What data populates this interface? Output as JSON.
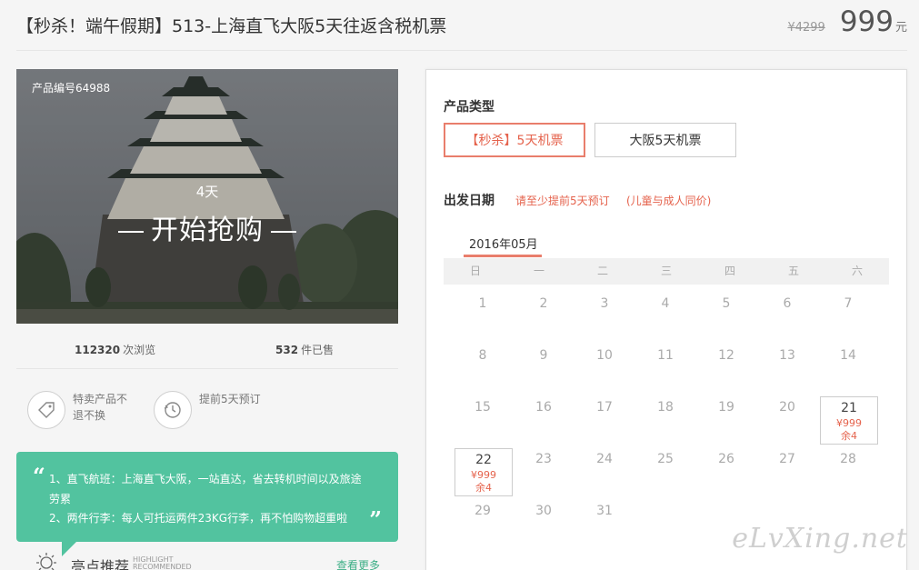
{
  "header": {
    "title": "【秒杀！端午假期】513-上海直飞大阪5天往返含税机票",
    "price_old": "¥4299",
    "price_new": "999",
    "price_unit": "元"
  },
  "hero": {
    "product_code": "产品编号64988",
    "days": "4天",
    "start_text": "开始抢购"
  },
  "stats": {
    "views_count": "112320",
    "views_label": "次浏览",
    "sold_count": "532",
    "sold_label": "件已售"
  },
  "features": [
    {
      "text": "特卖产品不退不换",
      "icon": "tag-icon"
    },
    {
      "text": "提前5天预订",
      "icon": "clock-icon"
    }
  ],
  "highlight": {
    "line1a": "1、直飞航班：上海直飞大阪，一站直达，省去转机时间以及旅途",
    "line1b": "劳累",
    "line2": "2、两件行李：每人可托运两件23KG行李，再不怕购物超重啦"
  },
  "recommend": {
    "title": "亮点推荐",
    "en1": "HIGHLIGHT",
    "en2": "RECOMMENDED",
    "more": "查看更多"
  },
  "booking": {
    "type_label": "产品类型",
    "types": [
      "【秒杀】5天机票",
      "大阪5天机票"
    ],
    "date_label": "出发日期",
    "date_hint": "请至少提前5天预订",
    "date_hint2": "(儿童与成人同价)",
    "month": "2016年05月",
    "weekdays": [
      "日",
      "一",
      "二",
      "三",
      "四",
      "五",
      "六"
    ],
    "days": [
      "1",
      "2",
      "3",
      "4",
      "5",
      "6",
      "7",
      "8",
      "9",
      "10",
      "11",
      "12",
      "13",
      "14",
      "15",
      "16",
      "17",
      "18",
      "19",
      "20",
      "21",
      "22",
      "23",
      "24",
      "25",
      "26",
      "27",
      "28",
      "29",
      "30",
      "31"
    ],
    "available": {
      "d21": {
        "price": "¥999",
        "remain": "余4"
      },
      "d22": {
        "price": "¥999",
        "remain": "余4"
      }
    }
  },
  "watermark": "eLvXing.net"
}
